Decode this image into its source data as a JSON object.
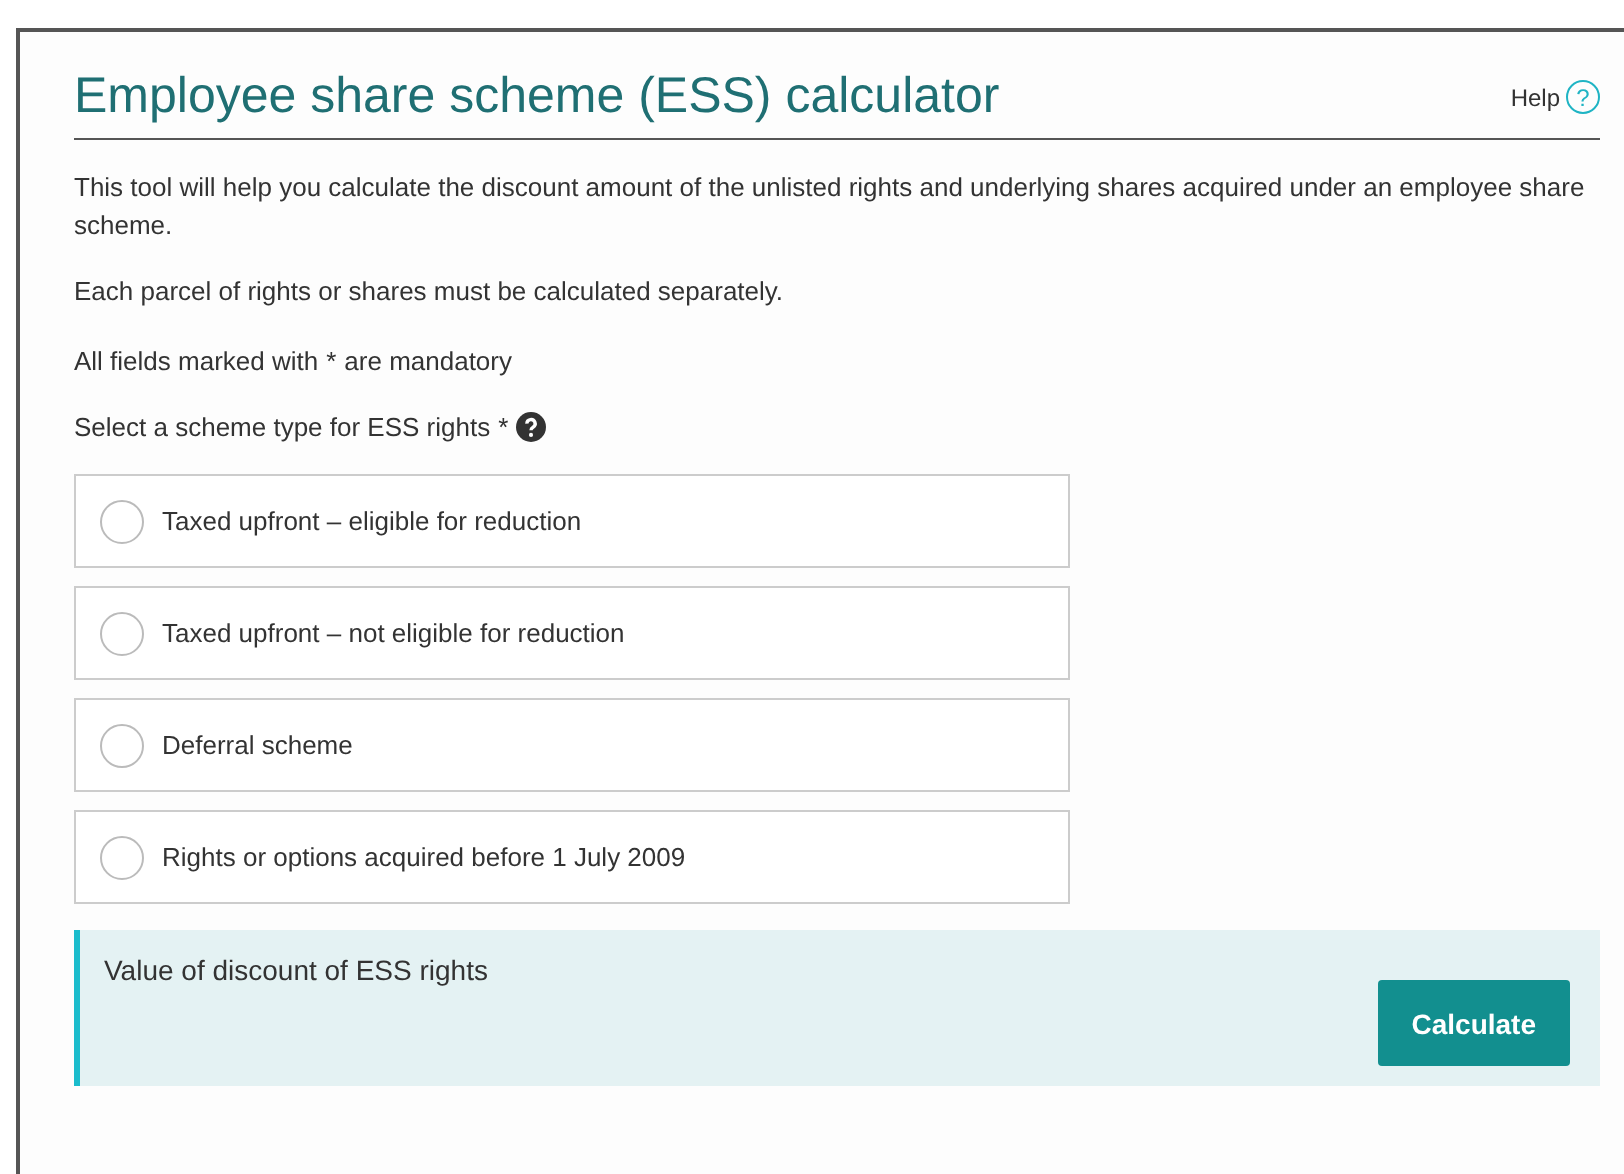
{
  "title": "Employee share scheme (ESS) calculator",
  "help": {
    "label": "Help",
    "icon": "?"
  },
  "intro": [
    "This tool will help you calculate the discount amount of the unlisted rights and underlying shares acquired under an employee share scheme.",
    "Each parcel of rights or shares must be calculated separately."
  ],
  "mandatory_note": {
    "before": "All fields marked with",
    "mark": "*",
    "after": "are mandatory"
  },
  "question": {
    "label": "Select a scheme type for ESS rights",
    "mark": "*"
  },
  "options": [
    {
      "label": "Taxed upfront – eligible for reduction",
      "selected": false
    },
    {
      "label": "Taxed upfront – not eligible for reduction",
      "selected": false
    },
    {
      "label": "Deferral scheme",
      "selected": false
    },
    {
      "label": "Rights or options acquired before 1 July 2009",
      "selected": false
    }
  ],
  "result": {
    "label": "Value of discount of ESS rights",
    "button": "Calculate"
  }
}
